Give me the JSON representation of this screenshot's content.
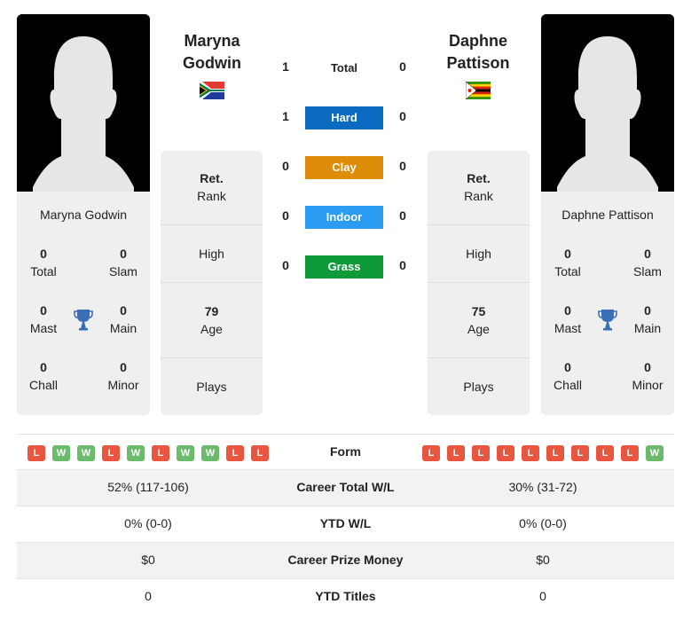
{
  "players": {
    "left": {
      "name": "Maryna Godwin",
      "name_line1": "Maryna",
      "name_line2": "Godwin",
      "flag": "south-africa-flag",
      "titles": {
        "total": "0",
        "slam": "0",
        "mast": "0",
        "main": "0",
        "chall": "0",
        "minor": "0"
      },
      "rank_label_bold": "Ret.",
      "rank_label": "Rank",
      "high_label": "High",
      "age_value": "79",
      "age_label": "Age",
      "plays_label": "Plays",
      "form": [
        "L",
        "W",
        "W",
        "L",
        "W",
        "L",
        "W",
        "W",
        "L",
        "L"
      ]
    },
    "right": {
      "name": "Daphne Pattison",
      "name_line1": "Daphne",
      "name_line2": "Pattison",
      "flag": "zimbabwe-flag",
      "titles": {
        "total": "0",
        "slam": "0",
        "mast": "0",
        "main": "0",
        "chall": "0",
        "minor": "0"
      },
      "rank_label_bold": "Ret.",
      "rank_label": "Rank",
      "high_label": "High",
      "age_value": "75",
      "age_label": "Age",
      "plays_label": "Plays",
      "form": [
        "L",
        "L",
        "L",
        "L",
        "L",
        "L",
        "L",
        "L",
        "L",
        "W"
      ]
    }
  },
  "title_labels": {
    "total": "Total",
    "slam": "Slam",
    "mast": "Mast",
    "main": "Main",
    "chall": "Chall",
    "minor": "Minor"
  },
  "head_to_head": [
    {
      "label": "Total",
      "left": "1",
      "right": "0",
      "color": null
    },
    {
      "label": "Hard",
      "left": "1",
      "right": "0",
      "color": "#0a6bc1"
    },
    {
      "label": "Clay",
      "left": "0",
      "right": "0",
      "color": "#dd8d0a"
    },
    {
      "label": "Indoor",
      "left": "0",
      "right": "0",
      "color": "#2b9cf2"
    },
    {
      "label": "Grass",
      "left": "0",
      "right": "0",
      "color": "#0f9a3a"
    }
  ],
  "form_label": "Form",
  "comparison_rows": [
    {
      "label": "Career Total W/L",
      "left": "52% (117-106)",
      "right": "30% (31-72)"
    },
    {
      "label": "YTD W/L",
      "left": "0% (0-0)",
      "right": "0% (0-0)"
    },
    {
      "label": "Career Prize Money",
      "left": "$0",
      "right": "$0"
    },
    {
      "label": "YTD Titles",
      "left": "0",
      "right": "0"
    }
  ],
  "colors": {
    "loss": "#e8563f",
    "win": "#6cbb6c",
    "trophy": "#3a6fb8"
  }
}
